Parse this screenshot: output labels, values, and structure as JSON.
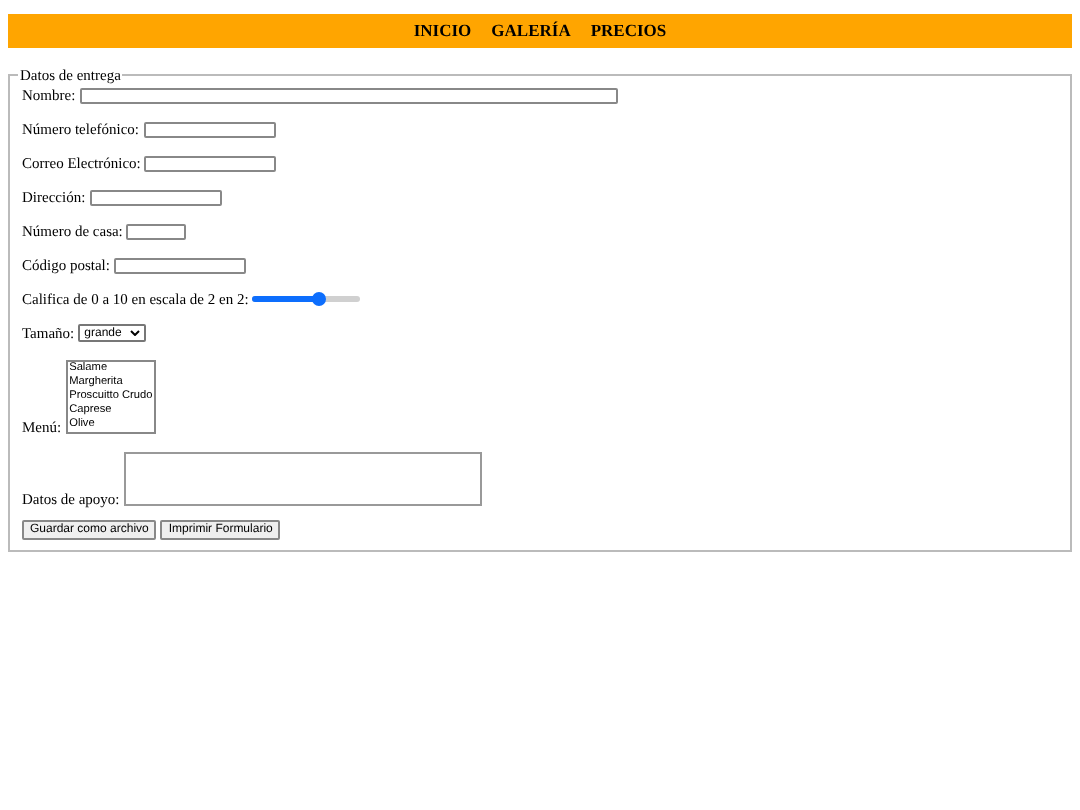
{
  "nav": [
    {
      "label": "INICIO"
    },
    {
      "label": "GALERÍA"
    },
    {
      "label": "PRECIOS"
    }
  ],
  "form": {
    "legend": "Datos de entrega",
    "fields": [
      {
        "kind": "text",
        "label": "Nombre:"
      },
      {
        "kind": "text",
        "label": "Número telefónico:"
      },
      {
        "kind": "text",
        "label": "Correo Electrónico:"
      },
      {
        "kind": "text",
        "label": "Dirección:"
      },
      {
        "kind": "text",
        "label": "Número de casa:"
      },
      {
        "kind": "text",
        "label": "Código postal:"
      },
      {
        "kind": "range",
        "label": "Califica de 0 a 10 en escala de 2 en 2:",
        "level": 0.6
      },
      {
        "kind": "select",
        "label": "Tamaño:",
        "value": "grande"
      },
      {
        "kind": "list",
        "label": "Menú:",
        "options": [
          "Salame",
          "Margherita",
          "Proscuitto Crudo",
          "Caprese",
          "Olive"
        ]
      },
      {
        "kind": "textarea",
        "label": "Datos de apoyo:"
      }
    ],
    "buttons": [
      "Guardar como archivo",
      "Imprimir Formulario"
    ]
  }
}
